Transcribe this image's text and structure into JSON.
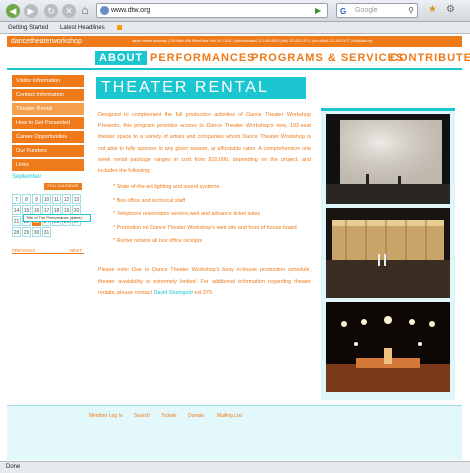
{
  "browser": {
    "url": "www.dtw.org",
    "search_placeholder": "Google",
    "bookmarks": [
      "Getting Started",
      "Latest Headlines"
    ],
    "status": "Done"
  },
  "site": {
    "logo_dance": "dance",
    "logo_theater": "theater",
    "logo_workshop": "workshop",
    "contact": "dance theater workshop | 219 West 19th Street New York, NY 10011 | (administration) 212-691-6500 | (fax) 212-633-1974 | (box office) 212-924-0077 | info@dtw.org"
  },
  "nav": [
    "ABOUT",
    "PERFORMANCES",
    "PROGRAMS & SERVICES",
    "CONTRIBUTE"
  ],
  "sidebar": [
    "Visitor Information",
    "Contact Information",
    "Theater Rental",
    "How to Get Presented",
    "Career Opportunities",
    "Our Funders",
    "Links"
  ],
  "calendar": {
    "month": "September",
    "full_label": "FULL CALENDAR",
    "rows": [
      [
        "7",
        "8",
        "9",
        "10",
        "11",
        "12",
        "13"
      ],
      [
        "14",
        "15",
        "16",
        "17",
        "18",
        "19",
        "20"
      ],
      [
        "21",
        "22",
        "23",
        "24",
        "25",
        "26",
        "27"
      ],
      [
        "28",
        "29",
        "30",
        "31"
      ]
    ],
    "tooltip": "Title of The Performance (dates)",
    "prev": "PREVIOUS",
    "next": "NEXT"
  },
  "content": {
    "title": "THEATER RENTAL",
    "intro": "Designed to complement the full production activities of Dance Theater Workshop Presents, this program provides access to Dance Theater Workshop's new, 192-seat theater space to a variety of artists and companies whom Dance Theater Workshop is not able to fully sponsor in any given season, at affordable rates. A comprehensive one week rental package ranges in cost from $10,000, depending on the project, and includes the following:",
    "bullets": [
      "* State-of-the-art lighting and sound systems",
      "* Box office and technical staff",
      "* Telephone reservation service,web and advance ticket sales",
      "* Promotion on Dance Theater Workshop's web site and front of house board",
      "* Renter retains all box office receipts"
    ],
    "note": "Please note: Due to Dance Theater Workshop's busy in-house production schedule, theater availability is extremely limited. For additional information regarding theater rentals, please contact",
    "contact_name": "David Sheingold",
    "contact_ext": "ext.379"
  },
  "footer": [
    "Member Log In",
    "Search",
    "Tickets",
    "Donate",
    "Mailing List"
  ],
  "colors": {
    "orange": "#ee7a1a",
    "teal": "#1cc6d1"
  }
}
